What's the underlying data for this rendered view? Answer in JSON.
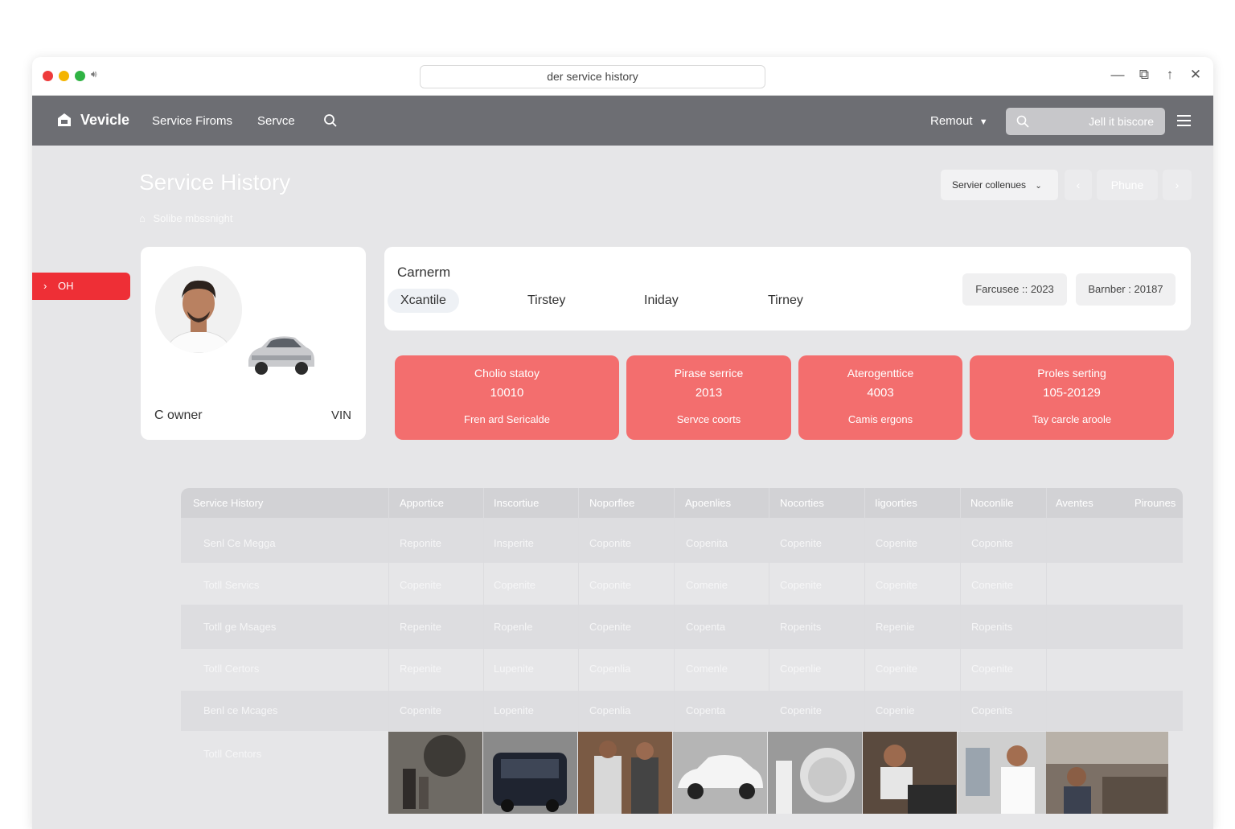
{
  "window": {
    "url": "der service history"
  },
  "navbar": {
    "brand": "Vevicle",
    "links": [
      "Service Firoms",
      "Servce"
    ],
    "account_menu": "Remout",
    "search_text": "Jell it biscore"
  },
  "header": {
    "title": "Service History",
    "breadcrumb": "Solibe mbssnight",
    "sort_label": "Servier collenues",
    "pager_prev": "‹",
    "pager_page": "Phune",
    "pager_next": "›"
  },
  "side_tag": {
    "label": "OH"
  },
  "profile": {
    "owner_label": "C owner",
    "vin_label": "VIN"
  },
  "info_card": {
    "title": "Carnerm",
    "tabs": [
      "Xcantile",
      "Tirstey",
      "Iniday",
      "Tirney"
    ],
    "active_tab": 0,
    "chips": [
      "Farcusee :: 2023",
      "Barnber : 20187"
    ]
  },
  "stats": [
    {
      "title": "Cholio statoy",
      "value": "10010",
      "sub": "Fren ard Sericalde"
    },
    {
      "title": "Pirase serrice",
      "value": "2013",
      "sub": "Servce coorts"
    },
    {
      "title": "Aterogenttice",
      "value": "4003",
      "sub": "Camis ergons"
    },
    {
      "title": "Proles serting",
      "value": "105-20129",
      "sub": "Tay carcle aroole"
    }
  ],
  "table": {
    "headers": [
      "Service History",
      "Apportice",
      "Inscortiue",
      "Noporflee",
      "Apoenlies",
      "Nocorties",
      "Iigoorties",
      "Noconlile",
      "Aventes",
      "Pirounes"
    ],
    "rows": [
      {
        "label": "Senl Ce Megga",
        "cells": [
          "Reponite",
          "Insperite",
          "Coponite",
          "Copenita",
          "Copenite",
          "Copenite",
          "Coponite"
        ]
      },
      {
        "label": "Totll Servics",
        "cells": [
          "Copenite",
          "Copenite",
          "Coponite",
          "Comenie",
          "Copenite",
          "Copenite",
          "Conenite"
        ]
      },
      {
        "label": "Totll ge Msages",
        "cells": [
          "Repenite",
          "Ropenle",
          "Copenite",
          "Copenta",
          "Ropenits",
          "Repenie",
          "Ropenits"
        ]
      },
      {
        "label": "Totll Certors",
        "cells": [
          "Repenite",
          "Lupenite",
          "Copenlia",
          "Comenle",
          "Copenlie",
          "Copenite",
          "Copenite"
        ]
      },
      {
        "label": "Benl ce Mcages",
        "cells": [
          "Copenite",
          "Lopenite",
          "Copenlia",
          "Copenta",
          "Copenite",
          "Copenie",
          "Copenits"
        ]
      },
      {
        "label": "Totll Centors",
        "cells": []
      }
    ]
  },
  "colors": {
    "accent_red": "#ee2f36",
    "stat_card": "#f36e6e",
    "navbar": "#6d6e73"
  }
}
